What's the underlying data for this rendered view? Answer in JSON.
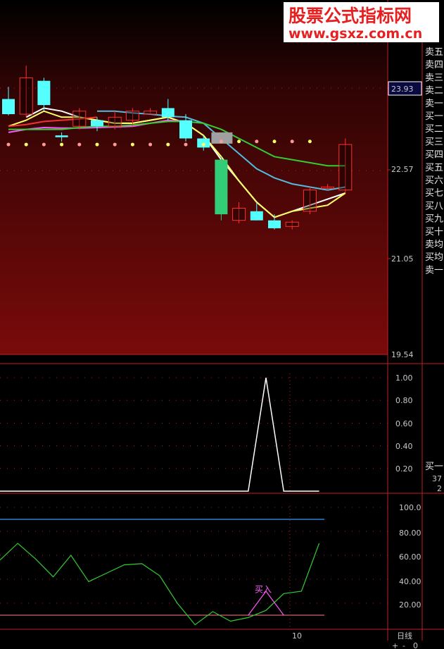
{
  "watermark": {
    "line1": "股票公式指标网",
    "line2": "www.gsxz.com.cn"
  },
  "price_tag": "23.93",
  "order_book": {
    "labels": [
      "卖五",
      "卖四",
      "卖三",
      "卖二",
      "卖一",
      "买一",
      "买二",
      "买三",
      "买四",
      "买五",
      "买六",
      "买七",
      "买八",
      "买九",
      "买十",
      "卖均",
      "买均",
      "卖一"
    ],
    "bottom_label": "买一",
    "bottom_values": [
      "37",
      "2"
    ]
  },
  "footer": {
    "period_label": "日线",
    "date_tick": "10",
    "buttons": [
      "+",
      "-",
      "0"
    ]
  },
  "colors": {
    "up": "#ff3030",
    "down": "#54ffff",
    "down_big": "#33cc77",
    "ma_white": "#ffffff",
    "ma_yellow": "#ffff66",
    "ma_magenta": "#ff55ff",
    "ma_green": "#33cc33",
    "ma_cyan": "#55bbdd",
    "ma_red": "#ee3333",
    "grid_dot": "#aa2222",
    "axis_line": "#c02020"
  },
  "chart_data": [
    {
      "type": "candlestick",
      "title": "",
      "ylim": [
        19.54,
        24.5
      ],
      "y_ticks": [
        "23.93",
        "22.57",
        "21.05",
        "19.54"
      ],
      "candles": [
        {
          "o": 23.75,
          "h": 23.95,
          "l": 23.48,
          "c": 23.5
        },
        {
          "o": 23.5,
          "h": 24.3,
          "l": 23.45,
          "c": 24.1
        },
        {
          "o": 24.05,
          "h": 24.1,
          "l": 23.55,
          "c": 23.65
        },
        {
          "o": 23.15,
          "h": 23.2,
          "l": 23.05,
          "c": 23.12
        },
        {
          "o": 23.3,
          "h": 23.6,
          "l": 23.25,
          "c": 23.55
        },
        {
          "o": 23.4,
          "h": 23.45,
          "l": 23.22,
          "c": 23.3
        },
        {
          "o": 23.3,
          "h": 23.55,
          "l": 23.25,
          "c": 23.45
        },
        {
          "o": 23.4,
          "h": 23.6,
          "l": 23.3,
          "c": 23.55
        },
        {
          "o": 23.5,
          "h": 23.6,
          "l": 23.5,
          "c": 23.55
        },
        {
          "o": 23.6,
          "h": 23.75,
          "l": 23.4,
          "c": 23.45
        },
        {
          "o": 23.4,
          "h": 23.5,
          "l": 23.05,
          "c": 23.1
        },
        {
          "o": 23.1,
          "h": 23.15,
          "l": 22.9,
          "c": 22.95
        },
        {
          "o": 22.75,
          "h": 22.8,
          "l": 21.75,
          "c": 21.85
        },
        {
          "o": 21.75,
          "h": 22.05,
          "l": 21.7,
          "c": 21.95
        },
        {
          "o": 21.9,
          "h": 22.05,
          "l": 21.75,
          "c": 21.75
        },
        {
          "o": 21.75,
          "h": 21.85,
          "l": 21.6,
          "c": 21.62
        },
        {
          "o": 21.65,
          "h": 21.75,
          "l": 21.6,
          "c": 21.72
        },
        {
          "o": 21.9,
          "h": 22.3,
          "l": 21.85,
          "c": 22.25
        },
        {
          "o": 22.28,
          "h": 22.35,
          "l": 22.25,
          "c": 22.3
        },
        {
          "o": 22.25,
          "h": 23.1,
          "l": 22.2,
          "c": 23.0
        }
      ],
      "ma": [
        {
          "color_key": "ma_white",
          "values": [
            null,
            23.45,
            23.6,
            23.55,
            23.45,
            23.4,
            23.35,
            23.35,
            23.4,
            23.45,
            23.35,
            23.15,
            22.75,
            22.4,
            22.05,
            21.8,
            21.9,
            22.0,
            22.1,
            22.2
          ]
        },
        {
          "color_key": "ma_yellow",
          "values": [
            23.3,
            23.4,
            23.55,
            23.45,
            23.45,
            23.4,
            23.35,
            23.35,
            23.4,
            23.45,
            23.35,
            23.15,
            22.8,
            22.4,
            22.05,
            21.8,
            21.9,
            21.95,
            22.0,
            22.2
          ]
        },
        {
          "color_key": "ma_magenta",
          "values": [
            23.2,
            23.25,
            23.28,
            23.27,
            23.27,
            23.28,
            23.29,
            23.3,
            23.35,
            23.4,
            23.38
          ]
        },
        {
          "color_key": "ma_red",
          "values": [
            23.3,
            23.33,
            23.38,
            23.4,
            23.42,
            23.45
          ]
        },
        {
          "color_key": "ma_cyan",
          "values": [
            null,
            null,
            null,
            null,
            null,
            23.55,
            23.55,
            23.52,
            23.5,
            23.47,
            23.45,
            23.35,
            23.1,
            22.85,
            22.6,
            22.45,
            22.35,
            22.3,
            22.25,
            22.3
          ]
        },
        {
          "color_key": "ma_green",
          "values": [
            23.25,
            23.25,
            23.25,
            23.25,
            23.28,
            23.3,
            23.3,
            23.32,
            23.35,
            23.38,
            23.38,
            23.35,
            23.25,
            23.1,
            22.95,
            22.8,
            22.75,
            22.7,
            22.65,
            22.65
          ]
        }
      ],
      "gray_box_candle": 12
    },
    {
      "type": "line",
      "title": "",
      "ylim": [
        0,
        1.1
      ],
      "y_ticks": [
        "1.00",
        "0.80",
        "0.60",
        "0.40",
        "0.20"
      ],
      "series": [
        {
          "values": [
            0,
            0,
            0,
            0,
            0,
            0,
            0,
            0,
            0,
            0,
            0,
            0,
            0,
            0,
            0,
            1,
            0,
            0,
            0
          ]
        }
      ]
    },
    {
      "type": "line",
      "title": "",
      "ylim": [
        0,
        105
      ],
      "y_ticks": [
        "100.0",
        "80.00",
        "60.00",
        "40.00",
        "20.00"
      ],
      "reference_line": 90,
      "threshold_line": 10,
      "series": [
        {
          "color_key": "ma_green",
          "values": [
            56,
            70,
            57,
            42,
            60,
            38,
            45,
            52,
            53,
            43,
            20,
            2,
            13,
            5,
            8,
            14,
            28,
            30,
            70
          ]
        },
        {
          "color_key": "ma_magenta",
          "values": [
            null,
            null,
            null,
            null,
            null,
            null,
            null,
            null,
            null,
            null,
            null,
            null,
            null,
            null,
            10,
            30,
            10,
            null,
            null
          ]
        }
      ],
      "annotation": {
        "text": "买入",
        "at_index": 15,
        "value": 28
      }
    }
  ]
}
